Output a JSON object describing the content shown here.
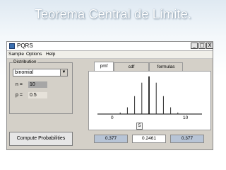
{
  "slide": {
    "title": "Teorema Central de Límite."
  },
  "app": {
    "title": "PQRS",
    "window_buttons": {
      "minimize": "_",
      "maximize": "□",
      "close": "X"
    },
    "menu": [
      "Sample",
      "Options",
      "Help"
    ]
  },
  "distribution": {
    "group_label": "Distribution",
    "selected": "binomial",
    "params": [
      {
        "label": "n =",
        "value": "10"
      },
      {
        "label": "p =",
        "value": "0.5"
      }
    ]
  },
  "compute_button": "Compute Probabilities",
  "tabs": [
    "pmf",
    "cdf",
    "formulas"
  ],
  "active_tab": "pmf",
  "plot": {
    "x_tick_labels": [
      "0",
      "5",
      "10"
    ],
    "slider_value": "5"
  },
  "results": {
    "left": "0.377",
    "center": "0.2461",
    "right": "0.377"
  },
  "chart_data": {
    "type": "bar",
    "categories": [
      "0",
      "1",
      "2",
      "3",
      "4",
      "5",
      "6",
      "7",
      "8",
      "9",
      "10"
    ],
    "values": [
      0.001,
      0.0098,
      0.0439,
      0.1172,
      0.2051,
      0.2461,
      0.2051,
      0.1172,
      0.0439,
      0.0098,
      0.001
    ],
    "title": "",
    "xlabel": "",
    "ylabel": "",
    "ylim": [
      0,
      0.25
    ]
  }
}
